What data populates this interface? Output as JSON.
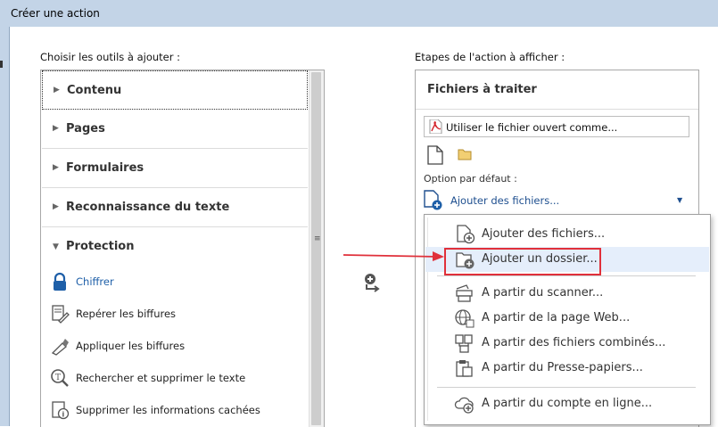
{
  "window": {
    "title": "Créer une action"
  },
  "left": {
    "heading": "Choisir les outils à ajouter :",
    "categories": [
      {
        "label": "Contenu",
        "expanded": false
      },
      {
        "label": "Pages",
        "expanded": false
      },
      {
        "label": "Formulaires",
        "expanded": false
      },
      {
        "label": "Reconnaissance du texte",
        "expanded": false
      },
      {
        "label": "Protection",
        "expanded": true
      }
    ],
    "tools": [
      {
        "label": "Chiffrer",
        "icon": "lock-icon",
        "color": "#1e5fa8"
      },
      {
        "label": "Repérer les biffures",
        "icon": "mark-redaction-icon"
      },
      {
        "label": "Appliquer les biffures",
        "icon": "apply-redaction-icon"
      },
      {
        "label": "Rechercher et supprimer le texte",
        "icon": "search-remove-text-icon"
      },
      {
        "label": "Supprimer les informations cachées",
        "icon": "remove-hidden-info-icon"
      }
    ]
  },
  "right": {
    "heading": "Etapes de l'action à afficher :",
    "section_title": "Fichiers à traiter",
    "file_field": "Utiliser le fichier ouvert comme...",
    "option_label": "Option par défaut :",
    "option_value": "Ajouter des fichiers..."
  },
  "menu": {
    "items": [
      {
        "label": "Ajouter des fichiers...",
        "icon": "add-file-icon",
        "highlighted": false
      },
      {
        "label": "Ajouter un dossier...",
        "icon": "add-folder-icon",
        "highlighted": true
      },
      {
        "label": "A partir du scanner...",
        "icon": "scanner-icon",
        "highlighted": false
      },
      {
        "label": "A partir de la page Web...",
        "icon": "web-page-icon",
        "highlighted": false
      },
      {
        "label": "A partir des fichiers combinés...",
        "icon": "combine-files-icon",
        "highlighted": false
      },
      {
        "label": "A partir du Presse-papiers...",
        "icon": "clipboard-icon",
        "highlighted": false
      },
      {
        "label": "A partir du compte en ligne...",
        "icon": "cloud-account-icon",
        "highlighted": false
      }
    ]
  },
  "colors": {
    "accent": "#1e5fa8",
    "annotation": "#e0303a",
    "highlight": "#e5eefb"
  }
}
